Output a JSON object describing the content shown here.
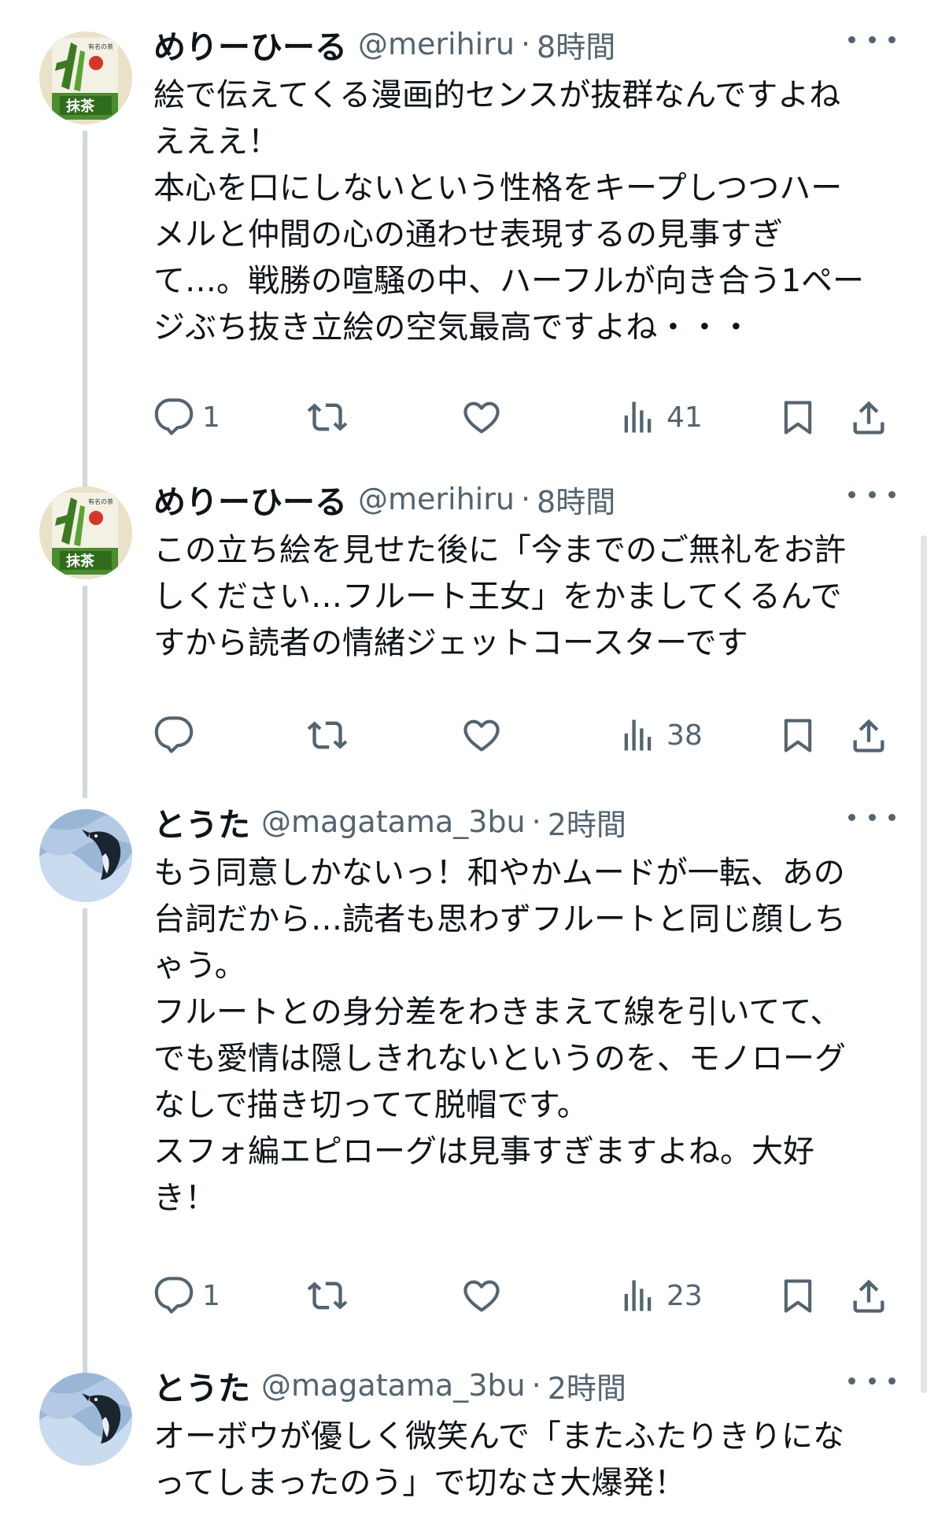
{
  "colors": {
    "text": "#0f1419",
    "secondary": "#536471",
    "thread_line": "#cfd9de"
  },
  "tweets": [
    {
      "avatar": "matcha-avatar",
      "name": "めりーひーる",
      "handle": "@merihiru",
      "separator": "·",
      "time": "8時間",
      "lines": [
        "絵で伝えてくる漫画的センスが抜群なんですよね",
        "えええ！",
        "本心を口にしないという性格をキープしつつハー",
        "メルと仲間の心の通わせ表現するの見事すぎ",
        "て…。戦勝の喧騒の中、ハーフルが向き合う1ペー",
        "ジぶち抜き立絵の空気最高ですよね・・・"
      ],
      "reply_count": "1",
      "retweet_count": "",
      "like_count": "",
      "view_count": "41"
    },
    {
      "avatar": "matcha-avatar",
      "name": "めりーひーる",
      "handle": "@merihiru",
      "separator": "·",
      "time": "8時間",
      "lines": [
        "この立ち絵を見せた後に「今までのご無礼をお許",
        "しください…フルート王女」をかましてくるんで",
        "すから読者の情緒ジェットコースターです"
      ],
      "reply_count": "",
      "retweet_count": "",
      "like_count": "",
      "view_count": "38"
    },
    {
      "avatar": "penguin-avatar",
      "name": "とうた",
      "handle": "@magatama_3bu",
      "separator": "·",
      "time": "2時間",
      "lines": [
        "もう同意しかないっ！和やかムードが一転、あの",
        "台詞だから…読者も思わずフルートと同じ顔しち",
        "ゃう。",
        "フルートとの身分差をわきまえて線を引いてて、",
        "でも愛情は隠しきれないというのを、モノローグ",
        "なしで描き切ってて脱帽です。",
        "スフォ編エピローグは見事すぎますよね。大好",
        "き！"
      ],
      "reply_count": "1",
      "retweet_count": "",
      "like_count": "",
      "view_count": "23"
    },
    {
      "avatar": "penguin-avatar",
      "name": "とうた",
      "handle": "@magatama_3bu",
      "separator": "·",
      "time": "2時間",
      "lines": [
        "オーボウが優しく微笑んで「またふたりきりにな",
        "ってしまったのう」で切なさ大爆発！"
      ]
    }
  ]
}
